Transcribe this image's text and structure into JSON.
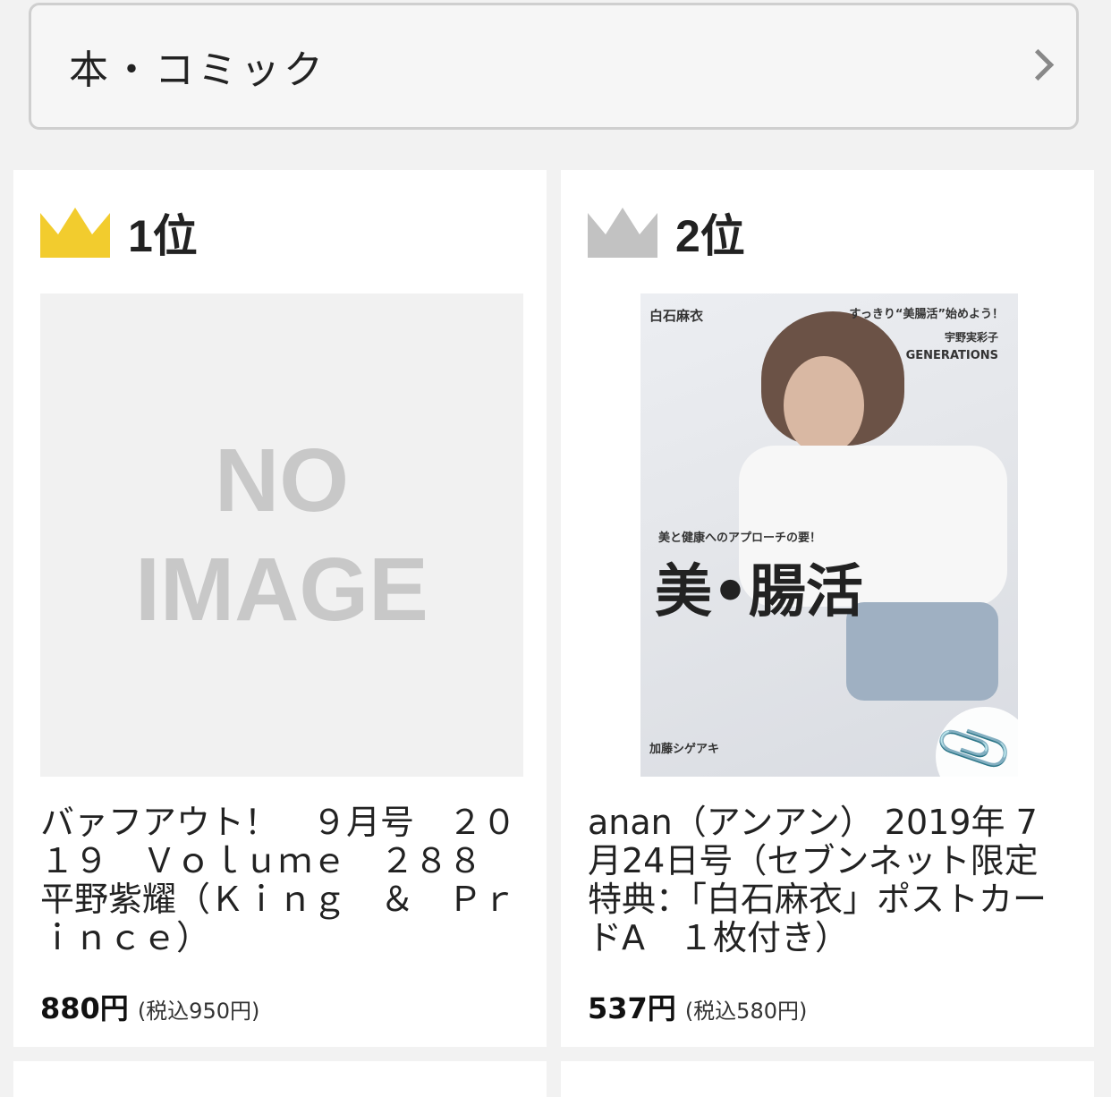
{
  "category": {
    "label": "本・コミック"
  },
  "products": [
    {
      "rank": "1位",
      "crown_color": "#f2cc2e",
      "image": {
        "line1": "NO",
        "line2": "IMAGE"
      },
      "title": "バァフアウト！　９月号　２０１９　Ｖｏｌｕｍｅ　２８８　平野紫耀（Ｋｉｎｇ　＆　Ｐｒｉｎｃｅ）",
      "price": "880円",
      "price_tax": "(税込950円)"
    },
    {
      "rank": "2位",
      "crown_color": "#c2c2c2",
      "cover": {
        "name": "白石麻衣",
        "top": "すっきり“美腸活”始めよう！",
        "right1": "宇野実彩子",
        "right2": "GENERATIONS",
        "sub": "美と健康へのアプローチの要！",
        "main": "美•腸活",
        "bottom": "加藤シゲアキ"
      },
      "title": "anan（アンアン） 2019年 7月24日号（セブンネット限定特典：「白石麻衣」ポストカードA　１枚付き）",
      "price": "537円",
      "price_tax": "(税込580円)"
    }
  ]
}
